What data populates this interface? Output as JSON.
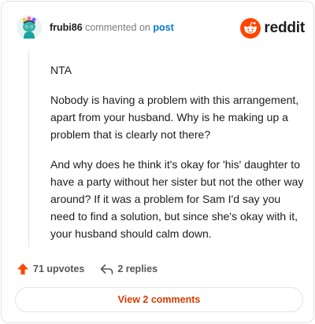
{
  "header": {
    "username": "frubi86",
    "verb": "commented on",
    "post_link": "post",
    "brand": "reddit",
    "avatar_icon": "snoo-avatar-icon",
    "brand_icon": "reddit-logo-icon"
  },
  "comment": {
    "paragraphs": [
      "NTA",
      "Nobody is having a problem with this arrangement, apart from your husband. Why is he making up a problem that is clearly not there?",
      "And why does he think it's okay for 'his' daughter to have a party without her sister but not the other way around? If it was a problem for Sam I'd say you need to find a solution, but since she's okay with it, your husband should calm down."
    ]
  },
  "footer": {
    "upvotes_label": "71 upvotes",
    "replies_label": "2 replies",
    "upvote_icon": "upvote-arrow-icon",
    "reply_icon": "reply-arrow-icon"
  },
  "view_button": {
    "label": "View 2 comments"
  },
  "colors": {
    "brand_orange": "#ff4500",
    "link_blue": "#0079d3",
    "button_text": "#d93a00"
  }
}
